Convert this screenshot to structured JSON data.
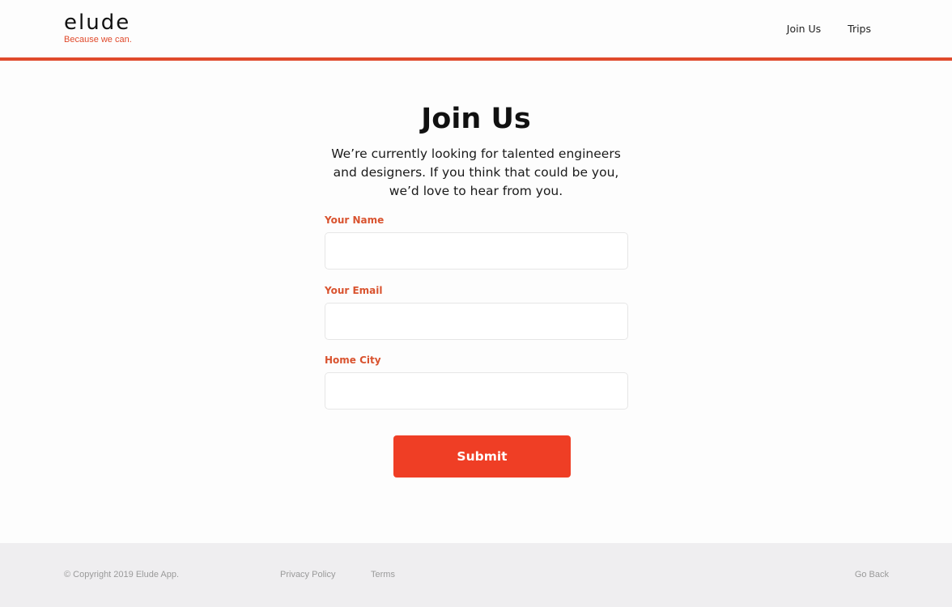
{
  "header": {
    "logo": "elude",
    "tagline": "Because we can.",
    "nav": [
      {
        "label": "Join Us"
      },
      {
        "label": "Trips"
      }
    ]
  },
  "main": {
    "title": "Join Us",
    "intro": "We’re currently looking for talented engineers and designers. If you think that could be you, we’d love to hear from you.",
    "fields": [
      {
        "label": "Your Name",
        "value": "",
        "placeholder": ""
      },
      {
        "label": "Your Email",
        "value": "",
        "placeholder": ""
      },
      {
        "label": "Home City",
        "value": "",
        "placeholder": ""
      }
    ],
    "submit_label": "Submit"
  },
  "footer": {
    "copyright": "© Copyright 2019 Elude App.",
    "privacy": "Privacy Policy",
    "terms": "Terms",
    "go_back": "Go Back"
  },
  "colors": {
    "accent": "#ef3e25",
    "label": "#d9532f",
    "footer_bg": "#efeef0",
    "footer_text": "#9a9a9a"
  }
}
